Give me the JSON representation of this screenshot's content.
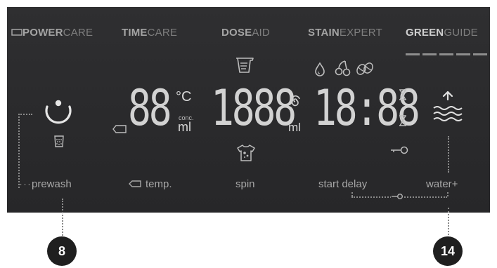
{
  "header": {
    "powercare": {
      "bold": "POWER",
      "light": "CARE"
    },
    "timecare": {
      "bold": "TIME",
      "light": "CARE"
    },
    "doseaid": {
      "bold": "DOSE",
      "light": "AID"
    },
    "stainexpert": {
      "bold": "STAIN",
      "light": "EXPERT"
    },
    "greenguide": {
      "bold": "GREEN",
      "light": "GUIDE"
    }
  },
  "display": {
    "temp_digits": "88",
    "temp_unit": "°C",
    "conc_label": "conc.",
    "ml_label": "ml",
    "dose_digits": "1888",
    "dose_unit": "ml",
    "time_digits": "18:88"
  },
  "buttons": {
    "prewash": "prewash",
    "temp": "temp.",
    "spin": "spin",
    "start_delay": "start delay",
    "water_plus": "water+"
  },
  "callouts": {
    "left": "8",
    "right": "14"
  },
  "icons": [
    "power-icon",
    "tag-icon",
    "detergent-cup-icon",
    "drop-icon",
    "cherries-icon",
    "coffee-beans-icon",
    "hourglass-icon",
    "key-icon",
    "water-level-icon",
    "shirt-stain-icon",
    "prewash-cup-icon",
    "spiral-icon"
  ],
  "colors": {
    "panel_bg": "#2c2c2e",
    "segment_on": "#cfcfcf",
    "label_text": "#a7a7a7",
    "callout_bg": "#1f1f1f"
  }
}
